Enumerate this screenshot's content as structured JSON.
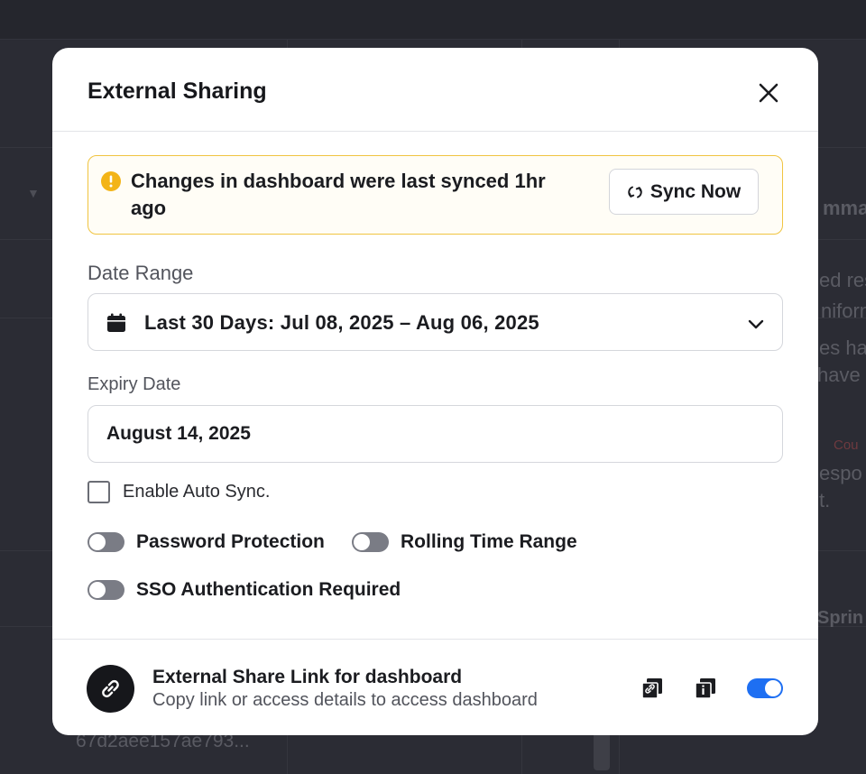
{
  "background": {
    "fragments": [
      "mma",
      "ed res",
      "niforn",
      "es ha",
      "have a",
      "Cou",
      "espo",
      "t.",
      "Sprin",
      "67d2aee157ae793..."
    ]
  },
  "modal": {
    "title": "External Sharing",
    "close_icon": "close-icon",
    "alert": {
      "icon": "warning-icon",
      "message": "Changes in dashboard were last synced 1hr ago",
      "sync_label": "Sync Now",
      "accent": "#f0c441"
    },
    "date_range": {
      "label": "Date Range",
      "value": "Last 30 Days: Jul 08, 2025 – Aug 06, 2025"
    },
    "expiry": {
      "label": "Expiry Date",
      "value": "August 14, 2025"
    },
    "auto_sync": {
      "label": "Enable Auto Sync.",
      "checked": false
    },
    "toggles": [
      {
        "label": "Password Protection",
        "on": false
      },
      {
        "label": "Rolling Time Range",
        "on": false
      },
      {
        "label": "SSO Authentication Required",
        "on": false
      }
    ],
    "footer": {
      "title": "External Share Link for dashboard",
      "subtitle": "Copy link or access details to access dashboard",
      "share_enabled": true,
      "toggle_color": "#1e6ff2"
    }
  }
}
